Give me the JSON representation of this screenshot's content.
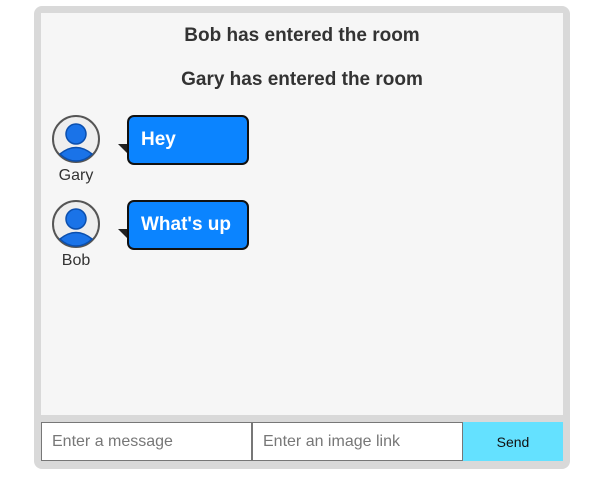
{
  "feed": {
    "system_messages": [
      "Bob has entered the room",
      "Gary has entered the room"
    ],
    "messages": [
      {
        "user": "Gary",
        "text": "Hey",
        "avatar_icon": "user-avatar-icon"
      },
      {
        "user": "Bob",
        "text": "What's up",
        "avatar_icon": "user-avatar-icon"
      }
    ]
  },
  "composer": {
    "message_placeholder": "Enter a message",
    "message_value": "",
    "image_placeholder": "Enter an image link",
    "image_value": "",
    "send_label": "Send"
  },
  "colors": {
    "frame": "#d9d9d9",
    "feed_background": "#f6f6f6",
    "bubble": "#0b84ff",
    "send_button": "#64e1ff"
  }
}
